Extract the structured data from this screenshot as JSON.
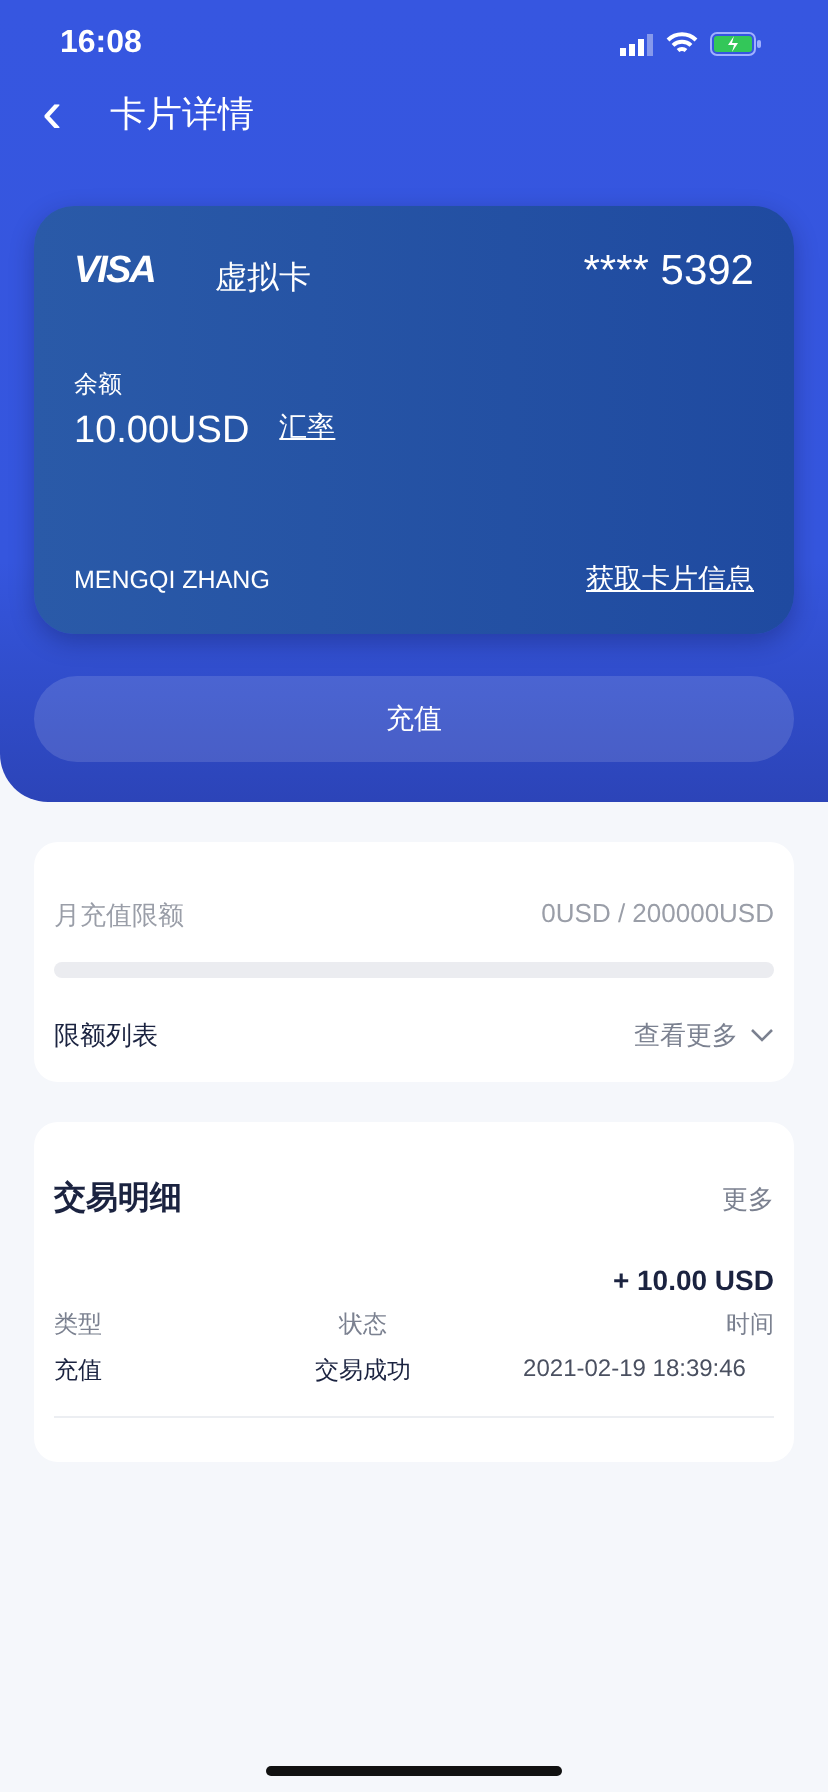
{
  "status_bar": {
    "time": "16:08"
  },
  "nav": {
    "back": "‹",
    "title": "卡片详情"
  },
  "card": {
    "brand": "VISA",
    "type": "虚拟卡",
    "number": "**** 5392",
    "balance_label": "余额",
    "balance": "10.00USD",
    "rate_link": "汇率",
    "holder": "MENGQI ZHANG",
    "info_link": "获取卡片信息"
  },
  "topup_button": "充值",
  "limit": {
    "label": "月充值限额",
    "value": "0USD / 200000USD",
    "level": 0,
    "list_label": "限额列表",
    "more": "查看更多"
  },
  "transactions": {
    "title": "交易明细",
    "more": "更多",
    "columns": [
      "类型",
      "状态",
      "时间"
    ],
    "rows": [
      {
        "amount": "+ 10.00 USD",
        "type": "充值",
        "status": "交易成功",
        "time": "2021-02-19 18:39:46"
      }
    ]
  }
}
